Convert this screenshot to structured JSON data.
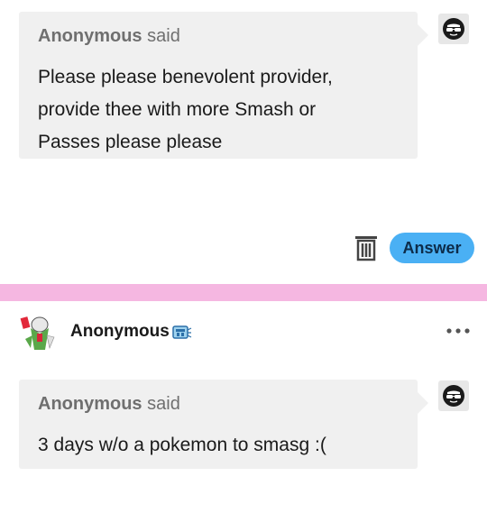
{
  "ask1": {
    "asker": "Anonymous",
    "said": "said",
    "lines": [
      "Please please benevolent provider,",
      "provide thee with more Smash or",
      "Passes please please"
    ]
  },
  "actions": {
    "answer_label": "Answer"
  },
  "divider_color": "#f5b7e1",
  "post2": {
    "username": "Anonymous",
    "ask": {
      "asker": "Anonymous",
      "said": "said",
      "text": "3 days w/o a pokemon to smasg :("
    }
  },
  "colors": {
    "accent": "#4ab0f4",
    "bubble": "#f0f0f0"
  }
}
